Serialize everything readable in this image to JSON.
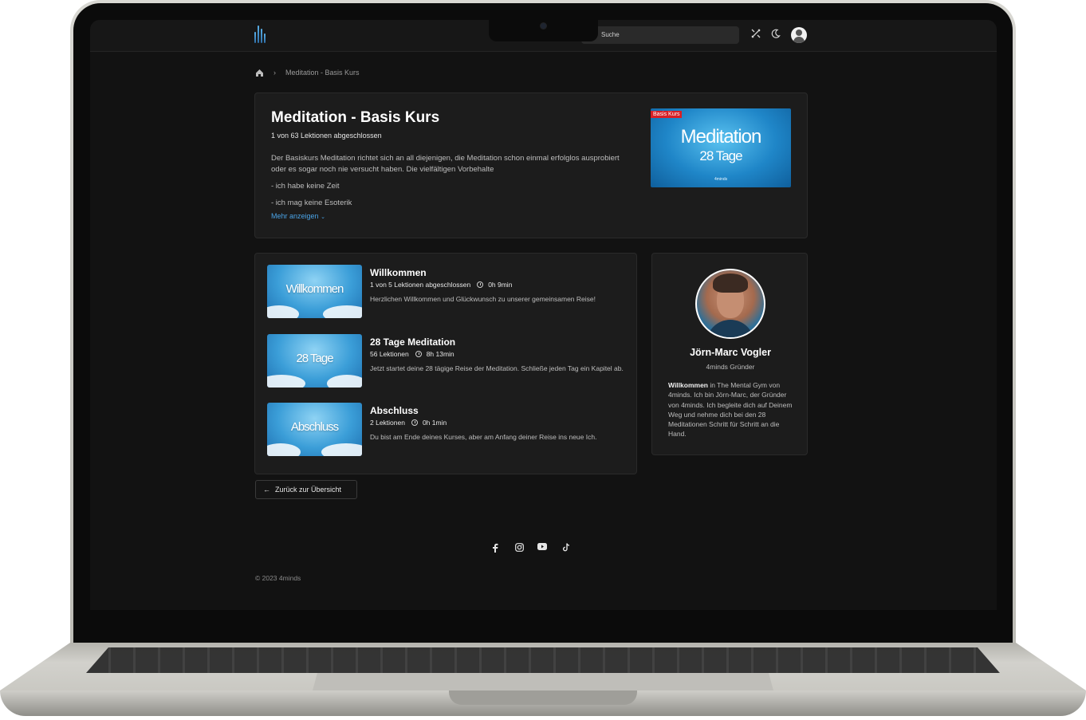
{
  "header": {
    "search_placeholder": "Suche",
    "icons": [
      "logo-icon",
      "search-icon",
      "tools-icon",
      "moon-icon",
      "user-avatar-icon"
    ]
  },
  "breadcrumb": {
    "current": "Meditation - Basis Kurs"
  },
  "course": {
    "title": "Meditation - Basis Kurs",
    "progress": "1 von 63 Lektionen abgeschlossen",
    "description": "Der Basiskurs Meditation richtet sich an all diejenigen, die Meditation schon einmal erfolglos ausprobiert oder es sogar noch nie versucht haben. Die vielfältigen Vorbehalte",
    "list_items": [
      "- ich habe keine Zeit",
      "- ich mag keine Esoterik"
    ],
    "more_label": "Mehr anzeigen",
    "image": {
      "badge": "Basis Kurs",
      "title": "Meditation",
      "subtitle": "28 Tage",
      "brand": "4minds"
    }
  },
  "chapters": [
    {
      "thumb_label": "Willkommen",
      "title": "Willkommen",
      "lessons": "1 von 5 Lektionen abgeschlossen",
      "duration": "0h 9min",
      "description": "Herzlichen Willkommen und Glückwunsch zu unserer gemeinsamen Reise!"
    },
    {
      "thumb_label": "28 Tage",
      "title": "28 Tage Meditation",
      "lessons": "56 Lektionen",
      "duration": "8h 13min",
      "description": "Jetzt startet deine 28 tägige Reise der Meditation. Schließe jeden Tag ein Kapitel ab."
    },
    {
      "thumb_label": "Abschluss",
      "title": "Abschluss",
      "lessons": "2 Lektionen",
      "duration": "0h 1min",
      "description": "Du bist am Ende deines Kurses, aber am Anfang deiner Reise ins neue Ich."
    }
  ],
  "author": {
    "name": "Jörn-Marc Vogler",
    "role": "4minds Gründer",
    "bio_bold": "Willkommen",
    "bio_rest": " in The Mental Gym von 4minds. Ich bin Jörn-Marc, der Gründer von 4minds. Ich begleite dich auf Deinem Weg und nehme dich bei den 28 Meditationen Schritt für Schritt an die Hand."
  },
  "back_button": {
    "label": "Zurück zur Übersicht"
  },
  "social": [
    "facebook-icon",
    "instagram-icon",
    "youtube-icon",
    "tiktok-icon"
  ],
  "footer": {
    "copyright": "© 2023 4minds"
  },
  "colors": {
    "background": "#121212",
    "card": "#1c1c1c",
    "accent_link": "#4aa3e6",
    "badge_red": "#d81f26"
  }
}
